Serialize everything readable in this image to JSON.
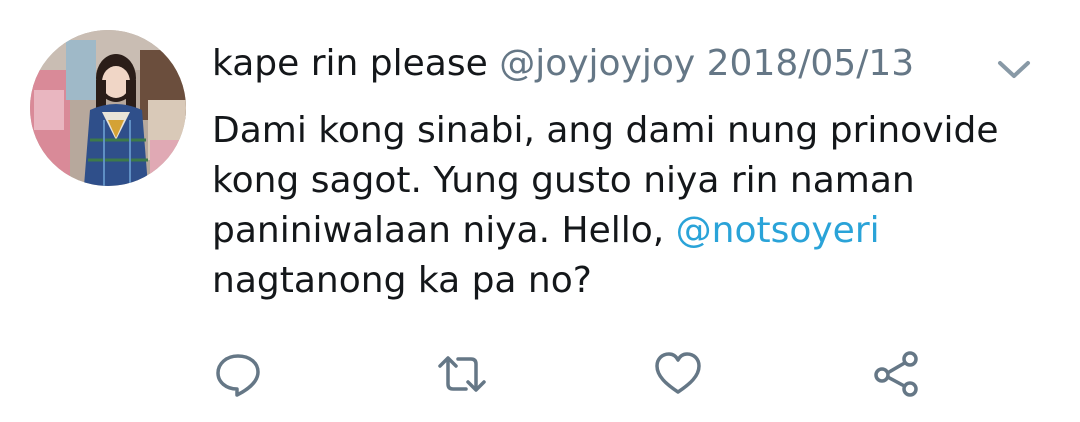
{
  "tweet": {
    "display_name": "kape rin please",
    "handle": "@joyjoyjoy",
    "date": "2018/05/13",
    "text_parts": [
      "Dami kong sinabi, ang dami nung prinovide kong sagot. Yung gusto niya rin naman paniniwalaan niya. Hello, ",
      " nagtanong ka pa no?"
    ],
    "mention": "@notsoyeri"
  },
  "icons": {
    "menu": "chevron-down-icon",
    "reply": "reply-icon",
    "retweet": "retweet-icon",
    "like": "heart-icon",
    "share": "share-icon"
  },
  "colors": {
    "text": "#14171a",
    "secondary": "#657786",
    "link": "#2aa3d8",
    "icon": "#657786"
  }
}
